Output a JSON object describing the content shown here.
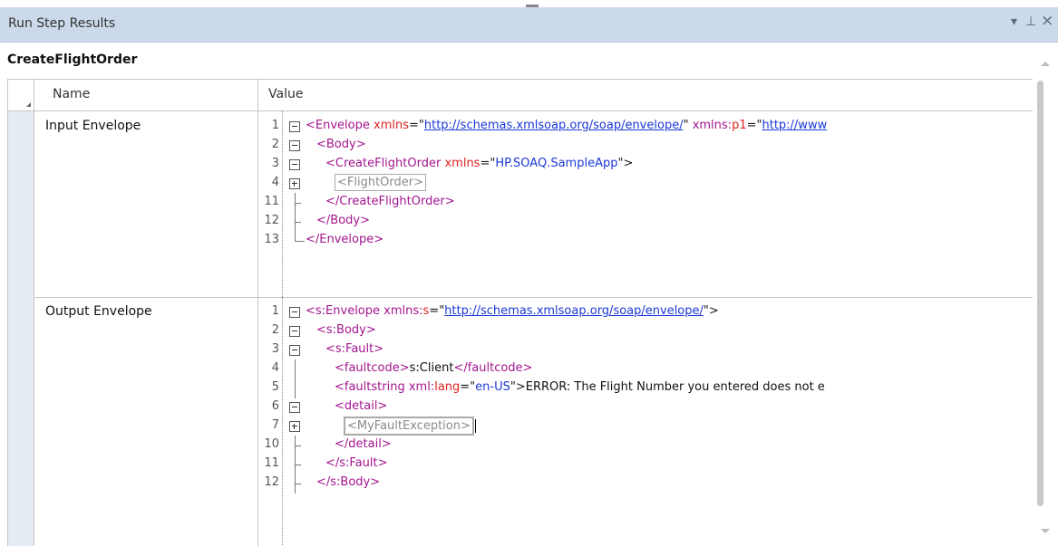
{
  "panel": {
    "title": "Run Step Results",
    "controls": {
      "menu": "▾",
      "pin": "⊥",
      "close": "×"
    },
    "subtitle": "CreateFlightOrder"
  },
  "grid": {
    "columns": {
      "name": "Name",
      "value": "Value"
    },
    "rows": [
      {
        "name": "Input Envelope",
        "lines": [
          {
            "num": "1",
            "fold": "minus",
            "parts": [
              {
                "c": "tag",
                "t": "<Envelope "
              },
              {
                "c": "attrn",
                "t": "xmlns"
              },
              {
                "c": "eq",
                "t": "=\""
              },
              {
                "c": "url",
                "t": "http://schemas.xmlsoap.org/soap/envelope/"
              },
              {
                "c": "eq",
                "t": "\" "
              },
              {
                "c": "attr",
                "t": "xmlns:"
              },
              {
                "c": "attrn",
                "t": "p1"
              },
              {
                "c": "eq",
                "t": "=\""
              },
              {
                "c": "url",
                "t": "http://www"
              }
            ]
          },
          {
            "num": "2",
            "fold": "minus",
            "parts": [
              {
                "c": "tag",
                "t": "<Body>"
              }
            ]
          },
          {
            "num": "3",
            "fold": "minus",
            "parts": [
              {
                "c": "tag",
                "t": "<CreateFlightOrder "
              },
              {
                "c": "attrn",
                "t": "xmlns"
              },
              {
                "c": "eq",
                "t": "=\""
              },
              {
                "c": "str",
                "t": "HP.SOAQ.SampleApp"
              },
              {
                "c": "eq",
                "t": "\">"
              }
            ]
          },
          {
            "num": "4",
            "fold": "plus",
            "collapsed": "<FlightOrder>"
          },
          {
            "num": "11",
            "fold": "tick",
            "parts": [
              {
                "c": "tag",
                "t": "</CreateFlightOrder>"
              }
            ]
          },
          {
            "num": "12",
            "fold": "tick",
            "parts": [
              {
                "c": "tag",
                "t": "</Body>"
              }
            ]
          },
          {
            "num": "13",
            "fold": "end",
            "parts": [
              {
                "c": "tag",
                "t": "</Envelope>"
              }
            ]
          }
        ]
      },
      {
        "name": "Output Envelope",
        "lines": [
          {
            "num": "1",
            "fold": "minus",
            "parts": [
              {
                "c": "tag",
                "t": "<s:Envelope "
              },
              {
                "c": "attr",
                "t": "xmlns:"
              },
              {
                "c": "attrn",
                "t": "s"
              },
              {
                "c": "eq",
                "t": "=\""
              },
              {
                "c": "url",
                "t": "http://schemas.xmlsoap.org/soap/envelope/"
              },
              {
                "c": "eq",
                "t": "\">"
              }
            ]
          },
          {
            "num": "2",
            "fold": "minus",
            "parts": [
              {
                "c": "tag",
                "t": "<s:Body>"
              }
            ]
          },
          {
            "num": "3",
            "fold": "minus",
            "parts": [
              {
                "c": "tag",
                "t": "<s:Fault>"
              }
            ]
          },
          {
            "num": "4",
            "fold": "line",
            "parts": [
              {
                "c": "tag",
                "t": "<faultcode>"
              },
              {
                "c": "txt",
                "t": "s:Client"
              },
              {
                "c": "tag",
                "t": "</faultcode>"
              }
            ]
          },
          {
            "num": "5",
            "fold": "line",
            "parts": [
              {
                "c": "tag",
                "t": "<faultstring "
              },
              {
                "c": "attr",
                "t": "xml:"
              },
              {
                "c": "attrn",
                "t": "lang"
              },
              {
                "c": "eq",
                "t": "=\""
              },
              {
                "c": "str",
                "t": "en-US"
              },
              {
                "c": "eq",
                "t": "\">"
              },
              {
                "c": "txt",
                "t": "ERROR: The Flight Number you entered does not e"
              }
            ]
          },
          {
            "num": "6",
            "fold": "minus",
            "parts": [
              {
                "c": "tag",
                "t": "<detail>"
              }
            ]
          },
          {
            "num": "7",
            "fold": "plus",
            "collapsed": "<MyFaultException>",
            "caret": true
          },
          {
            "num": "10",
            "fold": "tick",
            "parts": [
              {
                "c": "tag",
                "t": "</detail>"
              }
            ]
          },
          {
            "num": "11",
            "fold": "tick",
            "parts": [
              {
                "c": "tag",
                "t": "</s:Fault>"
              }
            ]
          },
          {
            "num": "12",
            "fold": "tick",
            "parts": [
              {
                "c": "tag",
                "t": "</s:Body>"
              }
            ]
          }
        ]
      }
    ]
  }
}
